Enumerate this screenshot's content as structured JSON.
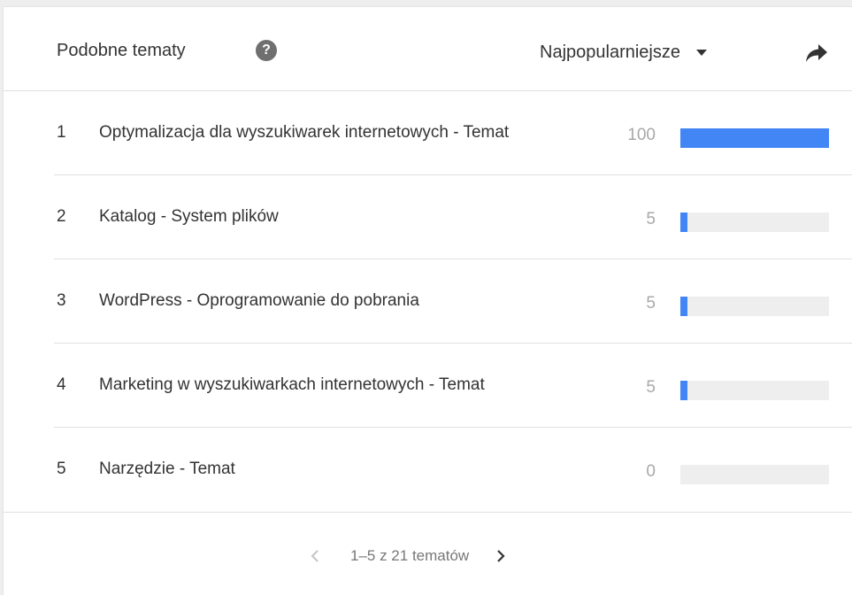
{
  "widget": {
    "title": "Podobne tematy",
    "sort_label": "Najpopularniejsze"
  },
  "items": [
    {
      "rank": "1",
      "name": "Optymalizacja dla wyszukiwarek internetowych - Temat",
      "value": "100",
      "fraction": 1.0
    },
    {
      "rank": "2",
      "name": "Katalog - System plików",
      "value": "5",
      "fraction": 0.05
    },
    {
      "rank": "3",
      "name": "WordPress - Oprogramowanie do pobrania",
      "value": "5",
      "fraction": 0.05
    },
    {
      "rank": "4",
      "name": "Marketing w wyszukiwarkach internetowych - Temat",
      "value": "5",
      "fraction": 0.05
    },
    {
      "rank": "5",
      "name": "Narzędzie - Temat",
      "value": "0",
      "fraction": 0.0
    }
  ],
  "pagination": {
    "label": "1–5 z 21 tematów"
  },
  "colors": {
    "bar": "#4285f4",
    "track": "#eeeeee"
  },
  "icons": [
    "help-icon",
    "dropdown-icon",
    "share-icon",
    "prev-icon",
    "next-icon"
  ]
}
